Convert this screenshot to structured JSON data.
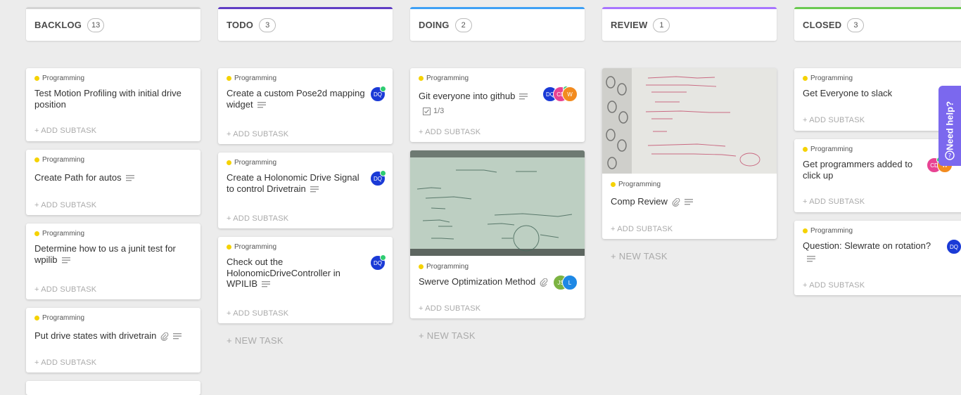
{
  "columns": [
    {
      "title": "BACKLOG",
      "count": "13",
      "color": "#d4d4d4"
    },
    {
      "title": "TODO",
      "count": "3",
      "color": "#5f3dc4"
    },
    {
      "title": "DOING",
      "count": "2",
      "color": "#3ea0f5"
    },
    {
      "title": "REVIEW",
      "count": "1",
      "color": "#a875ff"
    },
    {
      "title": "CLOSED",
      "count": "3",
      "color": "#6bc950"
    }
  ],
  "tag_label": "Programming",
  "add_subtask": "+ ADD SUBTASK",
  "new_task": "+ NEW TASK",
  "backlog": {
    "c1": "Test Motion Profiling with initial drive position",
    "c2": "Create Path for autos",
    "c3": "Determine how to us a junit test for wpilib",
    "c4": "Put drive states with drivetrain"
  },
  "todo": {
    "c1": "Create a custom Pose2d mapping widget",
    "c2": "Create a Holonomic Drive Signal to control Drivetrain",
    "c3": "Check out the HolonomicDriveController in WPILIB"
  },
  "doing": {
    "c1": "Git everyone into github",
    "c1_check": "1/3",
    "c2": "Swerve Optimization Method"
  },
  "review": {
    "c1": "Comp Review"
  },
  "closed": {
    "c1": "Get Everyone to slack",
    "c2": "Get programmers added to click up",
    "c3": "Question: Slewrate on rotation?"
  },
  "avatars": {
    "dq": "DQ",
    "cd": "CD",
    "w": "W",
    "js": "JS",
    "l": "L"
  },
  "help": "Need help?"
}
